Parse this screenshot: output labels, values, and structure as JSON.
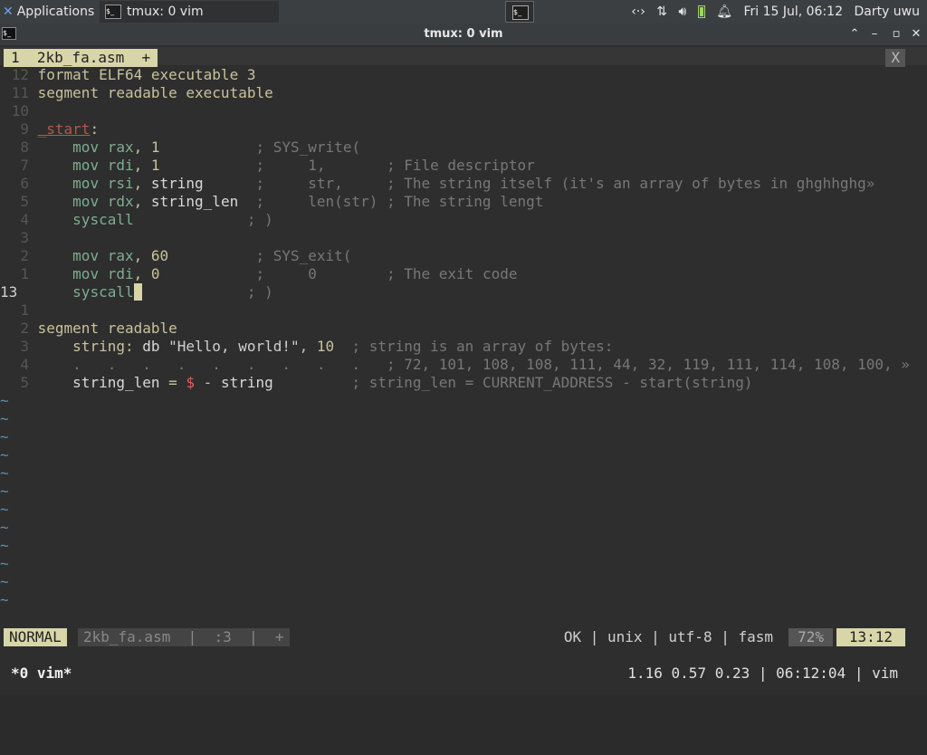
{
  "panel": {
    "apps_label": "Applications",
    "task_label": "tmux: 0 vim",
    "network_icon": "network-icon",
    "datetime": "Fri 15 Jul, 06:12",
    "user": "Darty uwu"
  },
  "window": {
    "title": "tmux: 0 vim",
    "buttons": [
      "minimize",
      "restore",
      "maximize",
      "close"
    ]
  },
  "vim": {
    "tab_label": "1  2kb_fa.asm  +",
    "tab_close": "X",
    "lines": [
      {
        "ln": "12",
        "segs": [
          [
            "kw",
            "format ELF64 executable 3"
          ]
        ]
      },
      {
        "ln": "11",
        "segs": [
          [
            "kw",
            "segment readable executable"
          ]
        ]
      },
      {
        "ln": "10",
        "segs": []
      },
      {
        "ln": "9",
        "segs": [
          [
            "lbl",
            "_start"
          ],
          [
            "op",
            ":"
          ]
        ]
      },
      {
        "ln": "8",
        "segs": [
          [
            "nm",
            "    "
          ],
          [
            "ins",
            "mov rax"
          ],
          [
            "op",
            ", "
          ],
          [
            "num",
            "1"
          ],
          [
            "nm",
            "           "
          ],
          [
            "cm",
            "; SYS_write("
          ]
        ]
      },
      {
        "ln": "7",
        "segs": [
          [
            "nm",
            "    "
          ],
          [
            "ins",
            "mov rdi"
          ],
          [
            "op",
            ", "
          ],
          [
            "num",
            "1"
          ],
          [
            "nm",
            "           "
          ],
          [
            "cm",
            ";     1,       ; File descriptor"
          ]
        ]
      },
      {
        "ln": "6",
        "segs": [
          [
            "nm",
            "    "
          ],
          [
            "ins",
            "mov rsi"
          ],
          [
            "op",
            ", "
          ],
          [
            "nm",
            "string"
          ],
          [
            "nm",
            "      "
          ],
          [
            "cm",
            ";     str,     ; The string itself (it's an array of bytes in ghghhghg»"
          ]
        ]
      },
      {
        "ln": "5",
        "segs": [
          [
            "nm",
            "    "
          ],
          [
            "ins",
            "mov rdx"
          ],
          [
            "op",
            ", "
          ],
          [
            "nm",
            "string_len"
          ],
          [
            "nm",
            "  "
          ],
          [
            "cm",
            ";     len(str) ; The string lengt"
          ]
        ]
      },
      {
        "ln": "4",
        "segs": [
          [
            "nm",
            "    "
          ],
          [
            "ins",
            "syscall"
          ],
          [
            "nm",
            "             "
          ],
          [
            "cm",
            "; )"
          ]
        ]
      },
      {
        "ln": "3",
        "segs": []
      },
      {
        "ln": "2",
        "segs": [
          [
            "nm",
            "    "
          ],
          [
            "ins",
            "mov rax"
          ],
          [
            "op",
            ", "
          ],
          [
            "num",
            "60"
          ],
          [
            "nm",
            "          "
          ],
          [
            "cm",
            "; SYS_exit("
          ]
        ]
      },
      {
        "ln": "1",
        "segs": [
          [
            "nm",
            "    "
          ],
          [
            "ins",
            "mov rdi"
          ],
          [
            "op",
            ", "
          ],
          [
            "num",
            "0"
          ],
          [
            "nm",
            "           "
          ],
          [
            "cm",
            ";     0        ; The exit code"
          ]
        ]
      },
      {
        "ln": "13",
        "cur": true,
        "segs": [
          [
            "nm",
            "    "
          ],
          [
            "ins",
            "syscall"
          ],
          [
            "cursor",
            " "
          ],
          [
            "nm",
            "            "
          ],
          [
            "cm",
            "; )"
          ]
        ]
      },
      {
        "ln": "1",
        "segs": []
      },
      {
        "ln": "2",
        "segs": [
          [
            "kw",
            "segment readable"
          ]
        ]
      },
      {
        "ln": "3",
        "segs": [
          [
            "nm",
            "    "
          ],
          [
            "op",
            "string:"
          ],
          [
            "nm",
            " db "
          ],
          [
            "str",
            "\"Hello, world!\""
          ],
          [
            "op",
            ", "
          ],
          [
            "num",
            "10"
          ],
          [
            "nm",
            "  "
          ],
          [
            "cm",
            "; string is an array of bytes:"
          ]
        ]
      },
      {
        "ln": "4",
        "segs": [
          [
            "cm",
            "    .   .   .   .   .   .   .   .   .   ; 72, 101, 108, 108, 111, 44, 32, 119, 111, 114, 108, 100, »"
          ]
        ]
      },
      {
        "ln": "5",
        "segs": [
          [
            "nm",
            "    string_len "
          ],
          [
            "op",
            "= "
          ],
          [
            "dl",
            "$"
          ],
          [
            "op",
            " - "
          ],
          [
            "nm",
            "string"
          ],
          [
            "nm",
            "         "
          ],
          [
            "cm",
            "; string_len = CURRENT_ADDRESS - start(string)"
          ]
        ]
      }
    ],
    "tilde_count": 12,
    "status": {
      "mode": "NORMAL",
      "fileinfo": "2kb_fa.asm  |  :3  |  +",
      "right": "OK | unix | utf-8 | fasm",
      "percent": "72%",
      "position": "13:12"
    }
  },
  "tmux": {
    "window": "*0 vim*",
    "right": "1.16 0.57 0.23 | 06:12:04 | vim"
  },
  "colors": {
    "accent": "#d8d6a8",
    "background": "#2e2e2e"
  }
}
